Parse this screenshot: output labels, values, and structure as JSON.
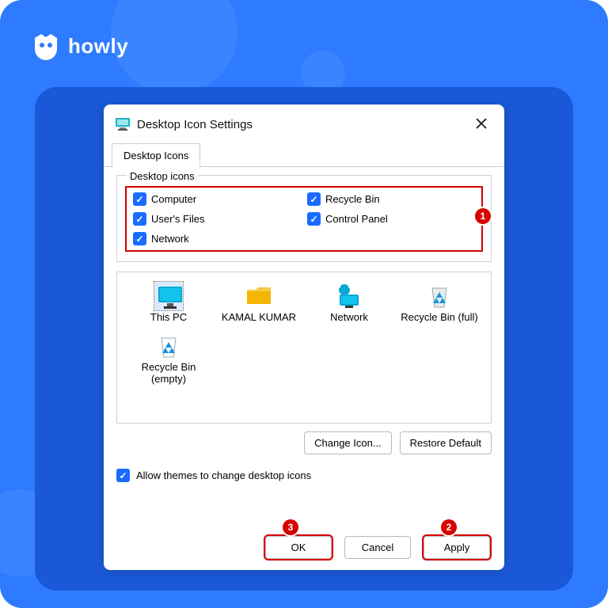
{
  "brand": {
    "name": "howly"
  },
  "dialog": {
    "title": "Desktop Icon Settings",
    "tab": "Desktop Icons",
    "groupLabel": "Desktop icons",
    "checks": {
      "computer": "Computer",
      "recycleBin": "Recycle Bin",
      "usersFiles": "User's Files",
      "controlPanel": "Control Panel",
      "network": "Network"
    },
    "icons": {
      "thisPC": "This PC",
      "user": "KAMAL KUMAR",
      "network": "Network",
      "recycleFull": "Recycle Bin (full)",
      "recycleEmpty": "Recycle Bin (empty)"
    },
    "changeIcon": "Change Icon...",
    "restoreDefault": "Restore Default",
    "allowThemes": "Allow themes to change desktop icons",
    "ok": "OK",
    "cancel": "Cancel",
    "apply": "Apply"
  },
  "markers": {
    "m1": "1",
    "m2": "2",
    "m3": "3"
  }
}
